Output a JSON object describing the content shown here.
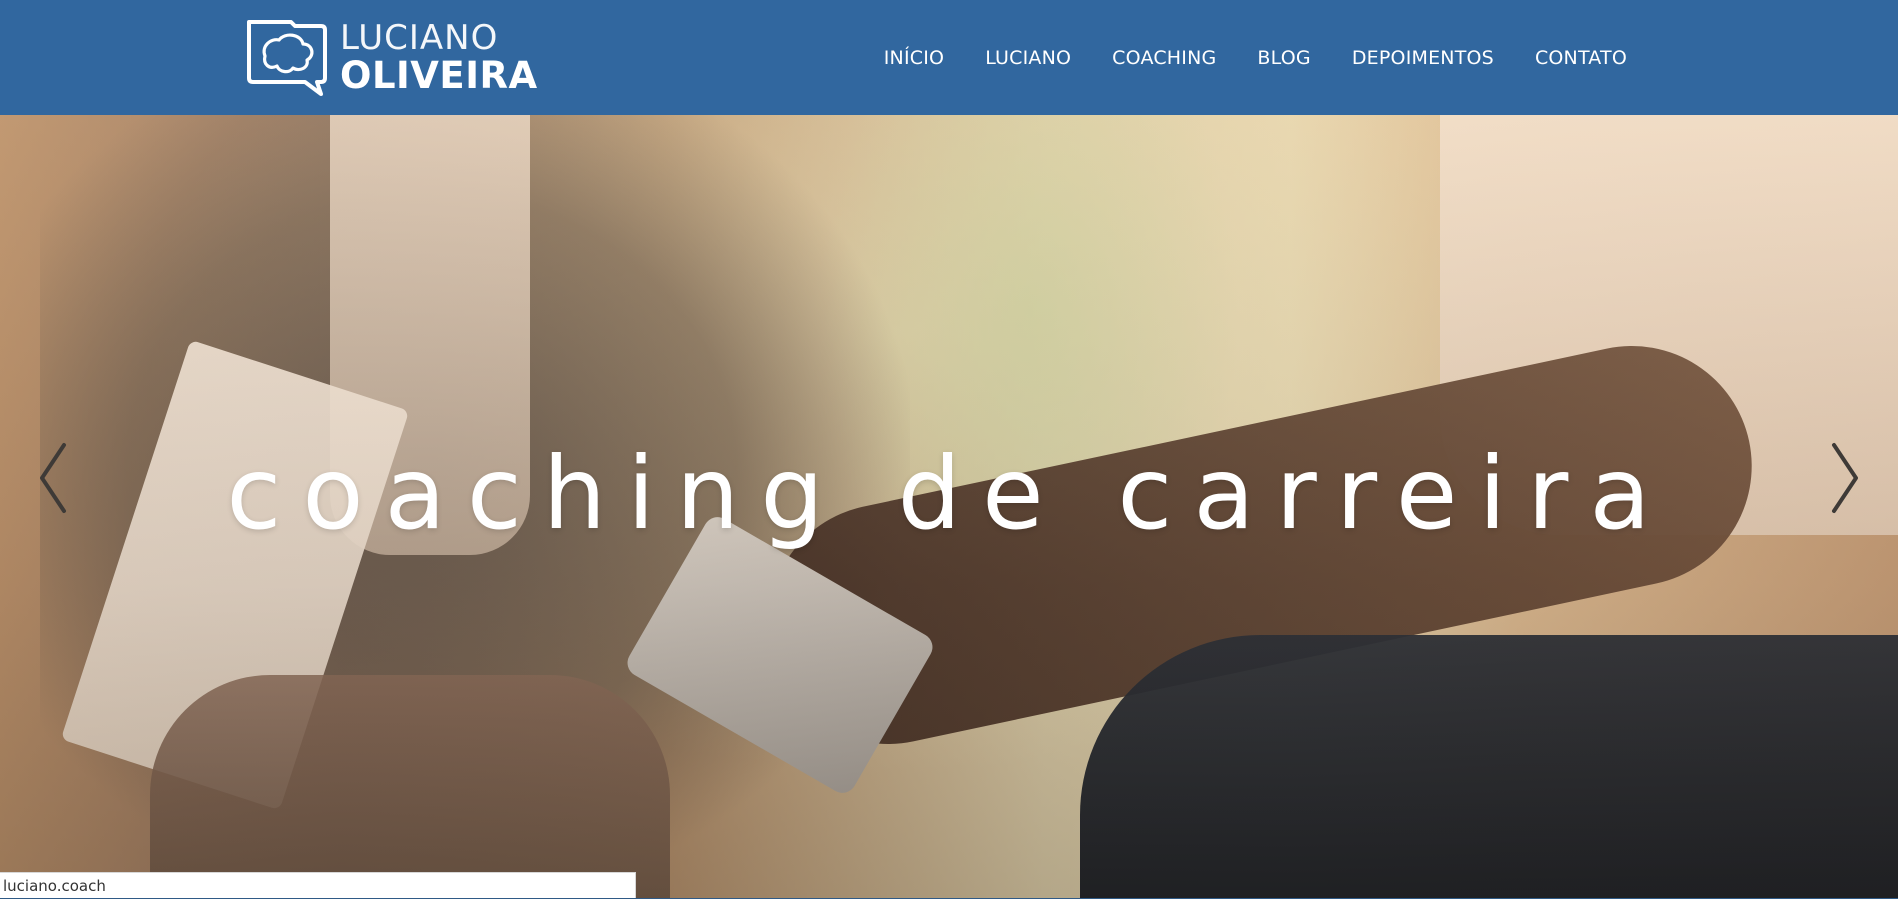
{
  "header": {
    "logo": {
      "line1": "LUCIANO",
      "line2": "OLIVEIRA"
    },
    "nav": [
      {
        "label": "INÍCIO"
      },
      {
        "label": "LUCIANO"
      },
      {
        "label": "COACHING"
      },
      {
        "label": "BLOG"
      },
      {
        "label": "DEPOIMENTOS"
      },
      {
        "label": "CONTATO"
      }
    ]
  },
  "hero": {
    "headline": "coaching de carreira",
    "prev_icon": "chevron-left-icon",
    "next_icon": "chevron-right-icon"
  },
  "statusbar": {
    "url": "luciano.coach"
  },
  "colors": {
    "header_bg": "#31679f",
    "text": "#ffffff"
  }
}
